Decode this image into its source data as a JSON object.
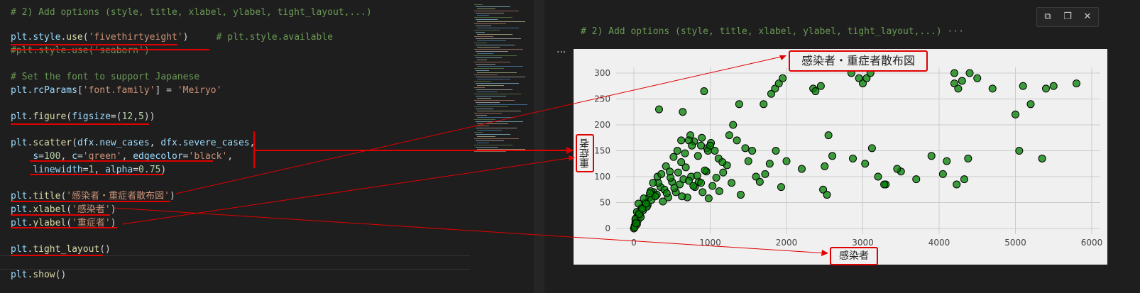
{
  "code": {
    "lines": [
      {
        "y": 8,
        "segments": [
          {
            "c": "c-com",
            "t": "# 2) Add options (style, title, xlabel, ylabel, tight_layout,...)"
          }
        ]
      },
      {
        "y": 43,
        "segments": [
          {
            "c": "c-var",
            "t": "plt"
          },
          {
            "c": "c-txt",
            "t": "."
          },
          {
            "c": "c-var",
            "t": "style"
          },
          {
            "c": "c-txt",
            "t": "."
          },
          {
            "c": "c-fn",
            "t": "use"
          },
          {
            "c": "c-txt",
            "t": "("
          },
          {
            "c": "c-str",
            "t": "'fivethirtyeight'"
          },
          {
            "c": "c-txt",
            "t": ")     "
          },
          {
            "c": "c-com",
            "t": "# plt.style.available"
          }
        ]
      },
      {
        "y": 62,
        "segments": [
          {
            "c": "c-com",
            "t": "#plt.style.use('seaborn')"
          }
        ]
      },
      {
        "y": 99,
        "segments": [
          {
            "c": "c-com",
            "t": "# Set the font to support Japanese"
          }
        ]
      },
      {
        "y": 118,
        "segments": [
          {
            "c": "c-var",
            "t": "plt"
          },
          {
            "c": "c-txt",
            "t": "."
          },
          {
            "c": "c-var",
            "t": "rcParams"
          },
          {
            "c": "c-txt",
            "t": "["
          },
          {
            "c": "c-str",
            "t": "'font.family'"
          },
          {
            "c": "c-txt",
            "t": "] = "
          },
          {
            "c": "c-str",
            "t": "'Meiryo'"
          }
        ]
      },
      {
        "y": 155,
        "segments": [
          {
            "c": "c-var",
            "t": "plt"
          },
          {
            "c": "c-txt",
            "t": "."
          },
          {
            "c": "c-fn",
            "t": "figure"
          },
          {
            "c": "c-txt",
            "t": "("
          },
          {
            "c": "c-var",
            "t": "figsize"
          },
          {
            "c": "c-txt",
            "t": "=("
          },
          {
            "c": "c-num",
            "t": "12"
          },
          {
            "c": "c-txt",
            "t": ","
          },
          {
            "c": "c-num",
            "t": "5"
          },
          {
            "c": "c-txt",
            "t": "))"
          }
        ]
      },
      {
        "y": 192,
        "segments": [
          {
            "c": "c-var",
            "t": "plt"
          },
          {
            "c": "c-txt",
            "t": "."
          },
          {
            "c": "c-fn",
            "t": "scatter"
          },
          {
            "c": "c-txt",
            "t": "("
          },
          {
            "c": "c-var",
            "t": "dfx"
          },
          {
            "c": "c-txt",
            "t": "."
          },
          {
            "c": "c-var",
            "t": "new_cases"
          },
          {
            "c": "c-txt",
            "t": ", "
          },
          {
            "c": "c-var",
            "t": "dfx"
          },
          {
            "c": "c-txt",
            "t": "."
          },
          {
            "c": "c-var",
            "t": "severe_cases"
          },
          {
            "c": "c-txt",
            "t": ","
          }
        ]
      },
      {
        "y": 211,
        "segments": [
          {
            "c": "c-txt",
            "t": "    "
          },
          {
            "c": "c-var",
            "t": "s"
          },
          {
            "c": "c-txt",
            "t": "="
          },
          {
            "c": "c-num",
            "t": "100"
          },
          {
            "c": "c-txt",
            "t": ", "
          },
          {
            "c": "c-var",
            "t": "c"
          },
          {
            "c": "c-txt",
            "t": "="
          },
          {
            "c": "c-str",
            "t": "'green'"
          },
          {
            "c": "c-txt",
            "t": ", "
          },
          {
            "c": "c-var",
            "t": "edgecolor"
          },
          {
            "c": "c-txt",
            "t": "="
          },
          {
            "c": "c-str",
            "t": "'black'"
          },
          {
            "c": "c-txt",
            "t": ","
          }
        ]
      },
      {
        "y": 230,
        "segments": [
          {
            "c": "c-txt",
            "t": "    "
          },
          {
            "c": "c-var",
            "t": "linewidth"
          },
          {
            "c": "c-txt",
            "t": "="
          },
          {
            "c": "c-num",
            "t": "1"
          },
          {
            "c": "c-txt",
            "t": ", "
          },
          {
            "c": "c-var",
            "t": "alpha"
          },
          {
            "c": "c-txt",
            "t": "="
          },
          {
            "c": "c-num",
            "t": "0.75"
          },
          {
            "c": "c-txt",
            "t": ")"
          }
        ]
      },
      {
        "y": 267,
        "segments": [
          {
            "c": "c-var",
            "t": "plt"
          },
          {
            "c": "c-txt",
            "t": "."
          },
          {
            "c": "c-fn",
            "t": "title"
          },
          {
            "c": "c-txt",
            "t": "("
          },
          {
            "c": "c-str",
            "t": "'感染者・重症者散布図'"
          },
          {
            "c": "c-txt",
            "t": ")"
          }
        ]
      },
      {
        "y": 286,
        "segments": [
          {
            "c": "c-var",
            "t": "plt"
          },
          {
            "c": "c-txt",
            "t": "."
          },
          {
            "c": "c-fn",
            "t": "xlabel"
          },
          {
            "c": "c-txt",
            "t": "("
          },
          {
            "c": "c-str",
            "t": "'感染者'"
          },
          {
            "c": "c-txt",
            "t": ")"
          }
        ]
      },
      {
        "y": 305,
        "segments": [
          {
            "c": "c-var",
            "t": "plt"
          },
          {
            "c": "c-txt",
            "t": "."
          },
          {
            "c": "c-fn",
            "t": "ylabel"
          },
          {
            "c": "c-txt",
            "t": "("
          },
          {
            "c": "c-str",
            "t": "'重症者'"
          },
          {
            "c": "c-txt",
            "t": ")"
          }
        ]
      },
      {
        "y": 342,
        "segments": [
          {
            "c": "c-var",
            "t": "plt"
          },
          {
            "c": "c-txt",
            "t": "."
          },
          {
            "c": "c-fn",
            "t": "tight_layout"
          },
          {
            "c": "c-txt",
            "t": "()"
          }
        ]
      },
      {
        "y": 378,
        "segments": [
          {
            "c": "c-var",
            "t": "plt"
          },
          {
            "c": "c-txt",
            "t": "."
          },
          {
            "c": "c-fn",
            "t": "show"
          },
          {
            "c": "c-txt",
            "t": "()"
          }
        ]
      }
    ]
  },
  "output": {
    "collapsed_header": "# 2) Add options (style, title, xlabel, ylabel, tight_layout,...) ···",
    "more": "···",
    "toolbar": {
      "copy_icon": "⧉",
      "paste_icon": "❐",
      "close_icon": "✕"
    }
  },
  "chart_data": {
    "type": "scatter",
    "title": "感染者・重症者散布図",
    "xlabel": "感染者",
    "ylabel": "重症者",
    "xlim": [
      -150,
      6100
    ],
    "ylim": [
      -8,
      310
    ],
    "xticks": [
      0,
      1000,
      2000,
      3000,
      4000,
      5000,
      6000
    ],
    "yticks": [
      0,
      50,
      100,
      150,
      200,
      250,
      300
    ],
    "grid": true,
    "marker_color": "#008000",
    "edge_color": "#000000",
    "x": [
      0,
      10,
      20,
      30,
      40,
      50,
      60,
      80,
      100,
      120,
      150,
      180,
      200,
      230,
      260,
      300,
      350,
      400,
      450,
      500,
      550,
      600,
      650,
      700,
      750,
      800,
      850,
      900,
      950,
      20,
      40,
      60,
      90,
      130,
      170,
      220,
      280,
      320,
      380,
      430,
      480,
      530,
      580,
      630,
      680,
      720,
      780,
      830,
      880,
      930,
      980,
      1030,
      1080,
      1120,
      1170,
      1220,
      1280,
      10,
      30,
      70,
      110,
      160,
      210,
      250,
      310,
      360,
      420,
      470,
      520,
      570,
      620,
      670,
      740,
      790,
      840,
      890,
      960,
      1010,
      1060,
      1110,
      1160,
      640,
      720,
      760,
      920,
      970,
      1000,
      1250,
      1300,
      1350,
      1380,
      1460,
      1500,
      1550,
      1600,
      1700,
      1800,
      1850,
      1900,
      1950,
      2000,
      2200,
      2350,
      2450,
      2500,
      2550,
      2600,
      2850,
      2950,
      3000,
      3050,
      3100,
      3200,
      3300,
      3500,
      3700,
      3900,
      4050,
      4100,
      4200,
      4250,
      4300,
      4400,
      4500,
      4700,
      5000,
      5050,
      5100,
      5200,
      5350,
      5400,
      5500,
      5800,
      330,
      620,
      880,
      1400,
      1650,
      1720,
      1780,
      1860,
      1930,
      2380,
      2480,
      2530,
      2870,
      3030,
      3120,
      3280,
      3450,
      4330,
      4380,
      4230,
      4200
    ],
    "y": [
      0,
      5,
      12,
      20,
      8,
      15,
      30,
      25,
      40,
      35,
      50,
      45,
      60,
      55,
      70,
      65,
      80,
      75,
      60,
      90,
      70,
      85,
      95,
      60,
      100,
      80,
      90,
      70,
      110,
      18,
      32,
      48,
      22,
      58,
      42,
      72,
      62,
      88,
      52,
      68,
      98,
      78,
      108,
      62,
      118,
      92,
      82,
      102,
      88,
      112,
      58,
      82,
      98,
      72,
      108,
      122,
      88,
      2,
      10,
      28,
      38,
      48,
      68,
      88,
      100,
      105,
      120,
      110,
      138,
      150,
      128,
      145,
      180,
      168,
      140,
      175,
      155,
      165,
      150,
      135,
      128,
      225,
      170,
      160,
      265,
      150,
      160,
      180,
      200,
      170,
      240,
      155,
      130,
      150,
      100,
      240,
      260,
      270,
      280,
      290,
      130,
      115,
      270,
      275,
      120,
      180,
      140,
      300,
      290,
      280,
      290,
      300,
      100,
      85,
      110,
      95,
      140,
      105,
      130,
      280,
      270,
      285,
      300,
      290,
      270,
      220,
      150,
      275,
      240,
      135,
      270,
      275,
      280,
      230,
      170,
      160,
      65,
      90,
      105,
      125,
      150,
      80,
      265,
      75,
      65,
      135,
      125,
      155,
      85,
      115,
      95,
      135,
      85,
      300,
      280,
      275,
      200
    ],
    "annotations": {
      "from": [
        "title",
        "xlabel",
        "ylabel",
        "scatter"
      ],
      "to": [
        "title",
        "xlabel",
        "ylabel",
        "ylabel"
      ]
    },
    "accent_color": "#e00000"
  }
}
